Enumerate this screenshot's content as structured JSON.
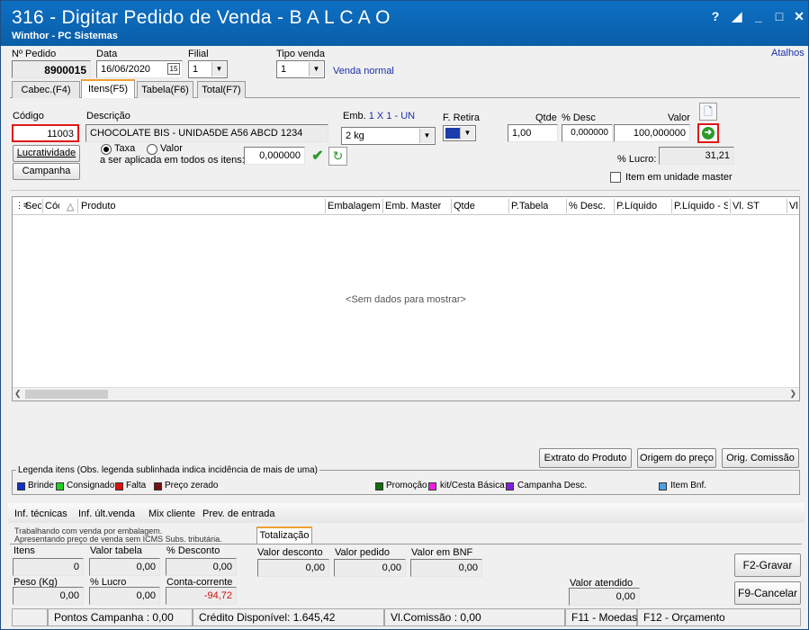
{
  "window": {
    "title": "316 - Digitar Pedido de Venda - B A L C A O",
    "subtitle": "Winthor - PC Sistemas",
    "atalhos": "Atalhos"
  },
  "header": {
    "pedido_label": "Nº Pedido",
    "pedido_value": "8900015",
    "data_label": "Data",
    "data_value": "16/06/2020",
    "filial_label": "Filial",
    "filial_value": "1",
    "tipo_venda_label": "Tipo venda",
    "tipo_venda_value": "1",
    "tipo_venda_desc": "Venda normal"
  },
  "tabs": [
    "Cabec.(F4)",
    "Itens(F5)",
    "Tabela(F6)",
    "Total(F7)"
  ],
  "item": {
    "codigo_label": "Código",
    "codigo_value": "11003",
    "descricao_label": "Descrição",
    "descricao_value": "CHOCOLATE BIS - UNIDA5DE A56 ABCD 1234",
    "emb_label": "Emb.",
    "emb_info": "1 X 1 - UN",
    "emb_value": "2 kg",
    "fretira_label": "F. Retira",
    "fretira_value": "",
    "qtde_label": "Qtde",
    "qtde_value": "1,00",
    "desc_label": "% Desc",
    "desc_value": "0,000000",
    "valor_label": "Valor",
    "valor_value": "100,000000",
    "lucratividade_btn": "Lucratividade",
    "campanha_btn": "Campanha",
    "taxa_label": "Taxa",
    "valor_radio_label": "Valor",
    "aplicada_label": "a ser aplicada em todos os itens:",
    "taxa_value": "0,000000",
    "lucro_label": "% Lucro:",
    "lucro_value": "31,21",
    "item_master_label": "Item em unidade master"
  },
  "grid": {
    "columns": [
      "Sec",
      "Cóc",
      "Produto",
      "Embalagem",
      "Emb. Master",
      "Qtde",
      "P.Tabela",
      "% Desc.",
      "P.Líquido",
      "P.Líquido - S",
      "Vl. ST",
      "Vl."
    ],
    "empty_text": "<Sem dados para mostrar>"
  },
  "actions": {
    "extrato": "Extrato do Produto",
    "origem": "Origem do preço",
    "comissao": "Orig. Comissão"
  },
  "legend": {
    "title": "Legenda itens (Obs. legenda sublinhada indica incidência de mais de uma)",
    "items": [
      {
        "label": "Brinde",
        "color": "#1030c8"
      },
      {
        "label": "Consignado",
        "color": "#20d020"
      },
      {
        "label": "Falta",
        "color": "#e01010"
      },
      {
        "label": "Preço zerado",
        "color": "#7a1010"
      },
      {
        "label": "Promoção",
        "color": "#107010"
      },
      {
        "label": "kit/Cesta Básica",
        "color": "#f020e0"
      },
      {
        "label": "Campanha Desc.",
        "color": "#8020e0"
      },
      {
        "label": "Item Bnf.",
        "color": "#50a0e0"
      }
    ]
  },
  "bottom_tabs": [
    "Inf. técnicas",
    "Inf. últ.venda",
    "Mix cliente",
    "Prev. de entrada"
  ],
  "info": {
    "line1": "Trabalhando com venda por embalagem.",
    "line2": "Apresentando preço de venda sem ICMS Subs. tributária.",
    "totalizacao_tab": "Totalização"
  },
  "totals": {
    "itens_label": "Itens",
    "itens_value": "0",
    "valor_tabela_label": "Valor tabela",
    "valor_tabela_value": "0,00",
    "pdesconto_label": "% Desconto",
    "pdesconto_value": "0,00",
    "peso_label": "Peso (Kg)",
    "peso_value": "0,00",
    "plucro_label": "% Lucro",
    "plucro_value": "0,00",
    "conta_label": "Conta-corrente",
    "conta_value": "-94,72",
    "valor_desconto_label": "Valor desconto",
    "valor_desconto_value": "0,00",
    "valor_pedido_label": "Valor pedido",
    "valor_pedido_value": "0,00",
    "valor_bnf_label": "Valor em BNF",
    "valor_bnf_value": "0,00",
    "valor_atendido_label": "Valor atendido",
    "valor_atendido_value": "0,00",
    "gravar_btn": "F2-Gravar",
    "cancelar_btn": "F9-Cancelar"
  },
  "status": {
    "pontos": "Pontos Campanha : 0,00",
    "credito": "Crédito Disponível: 1.645,42",
    "comissao": "Vl.Comissão : 0,00",
    "moedas": "F11 - Moedas",
    "orcamento": "F12 - Orçamento"
  }
}
